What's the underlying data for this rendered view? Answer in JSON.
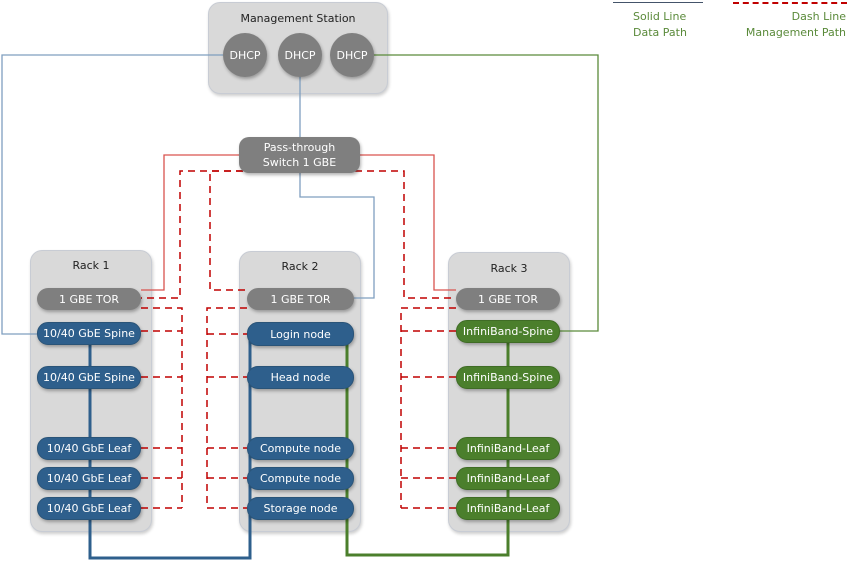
{
  "legend": {
    "solid": {
      "line1": "Solid Line",
      "line2": "Data Path",
      "color": "#44546a"
    },
    "dash": {
      "line1": "Dash Line",
      "line2": "Management Path",
      "color": "#c00000"
    }
  },
  "management_station": {
    "title": "Management Station",
    "dhcp": [
      "DHCP",
      "DHCP",
      "DHCP"
    ]
  },
  "pass_through": {
    "line1": "Pass-through",
    "line2": "Switch 1 GBE"
  },
  "racks": [
    {
      "title": "Rack 1",
      "nodes": [
        "1 GBE TOR",
        "10/40 GbE Spine",
        "10/40 GbE Spine",
        "10/40 GbE Leaf",
        "10/40 GbE Leaf",
        "10/40 GbE Leaf"
      ]
    },
    {
      "title": "Rack 2",
      "nodes": [
        "1 GBE TOR",
        "Login node",
        "Head node",
        "Compute node",
        "Compute node",
        "Storage node"
      ]
    },
    {
      "title": "Rack 3",
      "nodes": [
        "1 GBE TOR",
        "InfiniBand-Spine",
        "InfiniBand-Spine",
        "InfiniBand-Leaf",
        "InfiniBand-Leaf",
        "InfiniBand-Leaf"
      ]
    }
  ],
  "colors": {
    "tor": "#7f7f7f",
    "ethernet": "#2e5f8c",
    "infiniband": "#4b7f2c",
    "data_blue": "#7f9fbf",
    "data_green": "#5a8a3a",
    "mgmt_red": "#c0392b"
  }
}
